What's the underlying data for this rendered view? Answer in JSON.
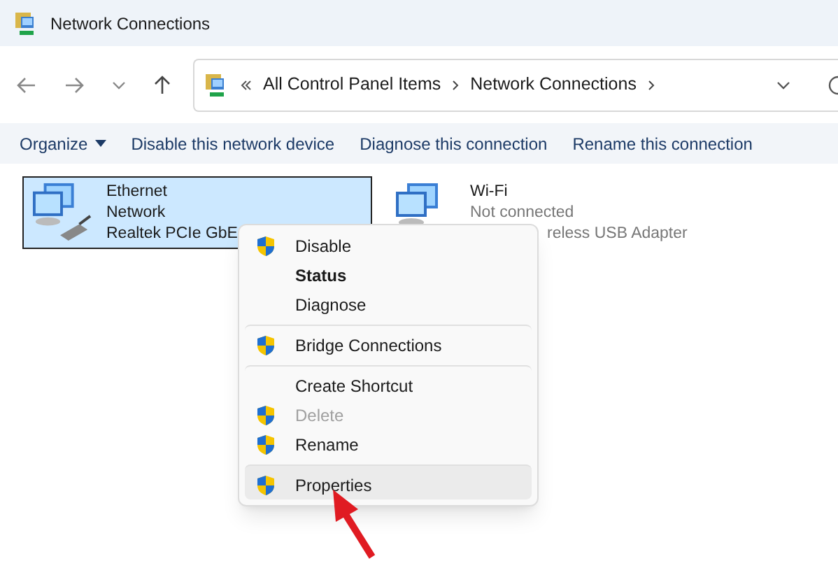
{
  "window": {
    "title": "Network Connections"
  },
  "address_bar": {
    "crumbs": [
      "All Control Panel Items",
      "Network Connections"
    ]
  },
  "toolbar": [
    {
      "label": "Organize",
      "kind": "dropdown"
    },
    {
      "label": "Disable this network device",
      "kind": "button"
    },
    {
      "label": "Diagnose this connection",
      "kind": "button"
    },
    {
      "label": "Rename this connection",
      "kind": "button"
    }
  ],
  "connections": [
    {
      "name": "Ethernet",
      "status": "Network",
      "adapter": "Realtek PCIe GbE",
      "selected": true,
      "kind": "wired"
    },
    {
      "name": "Wi-Fi",
      "status": "Not connected",
      "adapter": "reless USB Adapter",
      "selected": false,
      "kind": "wireless"
    }
  ],
  "context_menu": [
    {
      "label": "Disable",
      "shield": true,
      "bold": false,
      "disabled": false,
      "selected": false,
      "separator_before": false
    },
    {
      "label": "Status",
      "shield": false,
      "bold": true,
      "disabled": false,
      "selected": false,
      "separator_before": false
    },
    {
      "label": "Diagnose",
      "shield": false,
      "bold": false,
      "disabled": false,
      "selected": false,
      "separator_before": false
    },
    {
      "label": "Bridge Connections",
      "shield": true,
      "bold": false,
      "disabled": false,
      "selected": false,
      "separator_before": true
    },
    {
      "label": "Create Shortcut",
      "shield": false,
      "bold": false,
      "disabled": false,
      "selected": false,
      "separator_before": true
    },
    {
      "label": "Delete",
      "shield": true,
      "bold": false,
      "disabled": true,
      "selected": false,
      "separator_before": false
    },
    {
      "label": "Rename",
      "shield": true,
      "bold": false,
      "disabled": false,
      "selected": false,
      "separator_before": false
    },
    {
      "label": "Properties",
      "shield": true,
      "bold": false,
      "disabled": false,
      "selected": true,
      "separator_before": true
    }
  ]
}
